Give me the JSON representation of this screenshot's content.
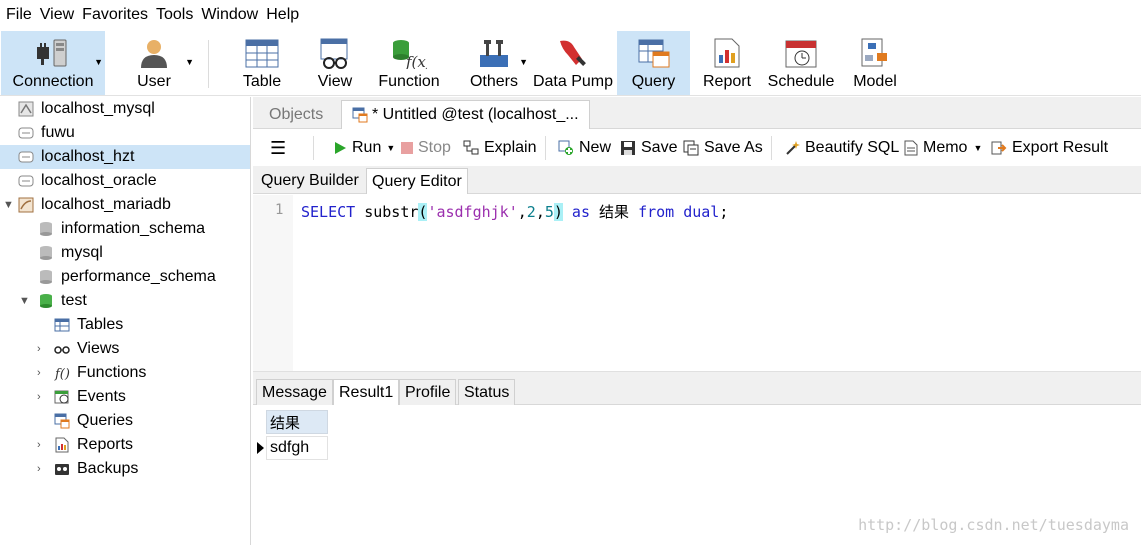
{
  "menu": [
    "File",
    "View",
    "Favorites",
    "Tools",
    "Window",
    "Help"
  ],
  "toolbar": {
    "connection": "Connection",
    "user": "User",
    "table": "Table",
    "view": "View",
    "function": "Function",
    "others": "Others",
    "data_pump": "Data Pump",
    "query": "Query",
    "report": "Report",
    "schedule": "Schedule",
    "model": "Model"
  },
  "sidebar": {
    "connections": [
      {
        "label": "localhost_mysql",
        "icon": "mysql-connection-icon"
      },
      {
        "label": "fuwu",
        "icon": "connection-icon"
      },
      {
        "label": "localhost_hzt",
        "icon": "connection-icon",
        "selected": true
      },
      {
        "label": "localhost_oracle",
        "icon": "connection-icon"
      },
      {
        "label": "localhost_mariadb",
        "icon": "mariadb-connection-icon"
      }
    ],
    "databases": [
      "information_schema",
      "mysql",
      "performance_schema",
      "test"
    ],
    "test_children": [
      "Tables",
      "Views",
      "Functions",
      "Events",
      "Queries",
      "Reports",
      "Backups"
    ]
  },
  "tabs": {
    "objects": "Objects",
    "query": "* Untitled @test (localhost_..."
  },
  "query_toolbar": {
    "run": "Run",
    "stop": "Stop",
    "explain": "Explain",
    "new": "New",
    "save": "Save",
    "save_as": "Save As",
    "beautify": "Beautify SQL",
    "memo": "Memo",
    "export": "Export Result"
  },
  "subtabs": {
    "builder": "Query Builder",
    "editor": "Query Editor"
  },
  "editor": {
    "line_number": "1",
    "kw_select": "SELECT",
    "func": " substr",
    "open_paren": "(",
    "string": "'asdfghjk'",
    "comma1": ",",
    "arg2": "2",
    "comma2": ",",
    "arg3": "5",
    "close_paren": ")",
    "kw_as": " as",
    "alias": " 结果 ",
    "kw_from": "from",
    "table": " dual",
    "semicolon": ";"
  },
  "result_tabs": [
    "Message",
    "Result1",
    "Profile",
    "Status"
  ],
  "result": {
    "column": "结果",
    "value": "sdfgh"
  },
  "watermark": "http://blog.csdn.net/tuesdayma"
}
